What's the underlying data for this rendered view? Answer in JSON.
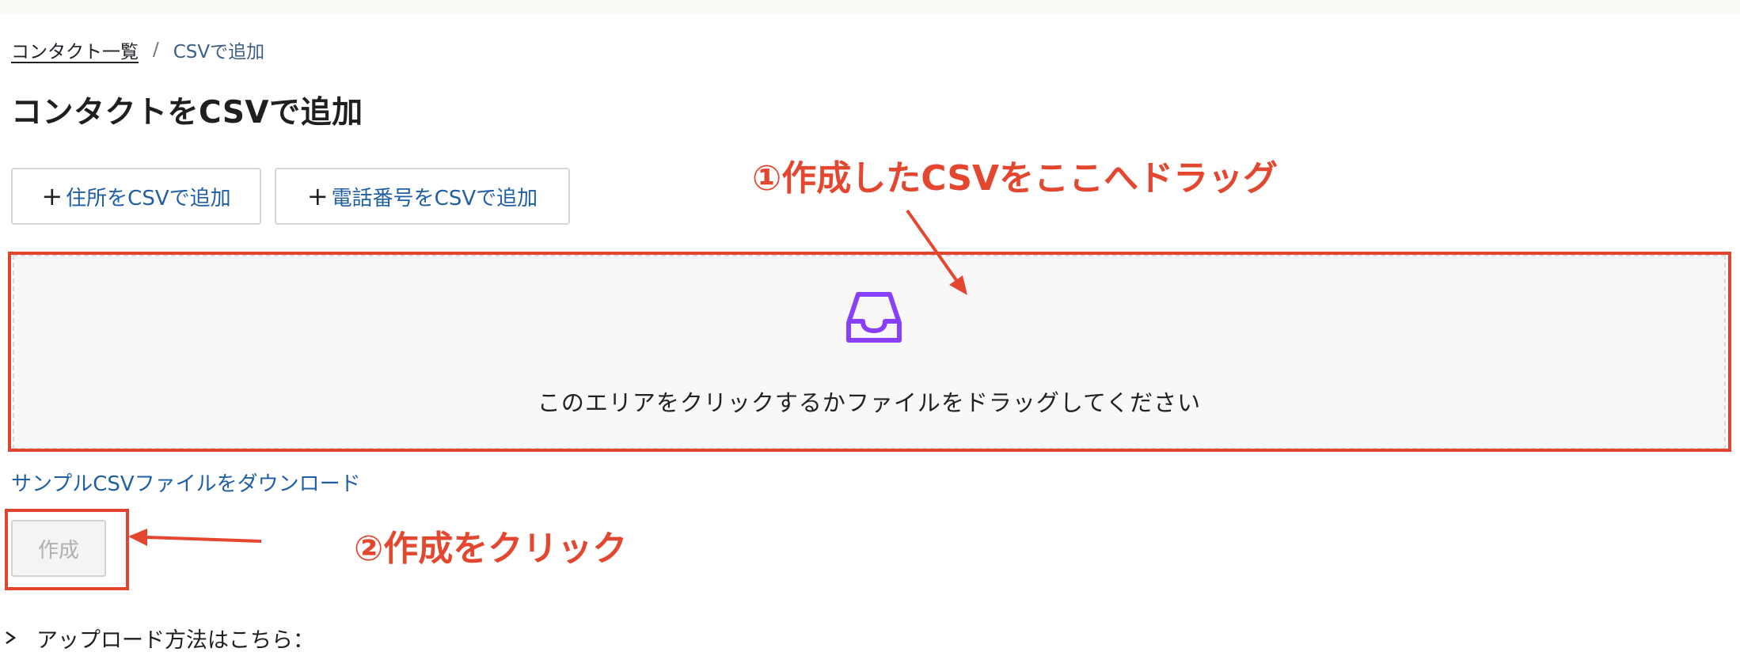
{
  "breadcrumb": {
    "link_label": "コンタクト一覧",
    "separator": "/",
    "current_label": "CSVで追加"
  },
  "page": {
    "title": "コンタクトをCSVで追加"
  },
  "actions": {
    "plus_symbol": "+",
    "add_address_label": "住所をCSVで追加",
    "add_phone_label": "電話番号をCSVで追加"
  },
  "dropzone": {
    "icon": "inbox-icon",
    "text": "このエリアをクリックするかファイルをドラッグしてください"
  },
  "sample_link": {
    "label": "サンプルCSVファイルをダウンロード"
  },
  "create_button": {
    "label": "作成",
    "disabled": true
  },
  "upload_howto": {
    "label": "アップロード方法はこちら："
  },
  "annotations": {
    "step1": "①作成したCSVをここへドラッグ",
    "step2": "②作成をクリック",
    "color": "#e4472f"
  },
  "colors": {
    "link": "#1f5fa6",
    "icon_purple": "#8a3ffc",
    "annotation_red": "#e4472f"
  }
}
